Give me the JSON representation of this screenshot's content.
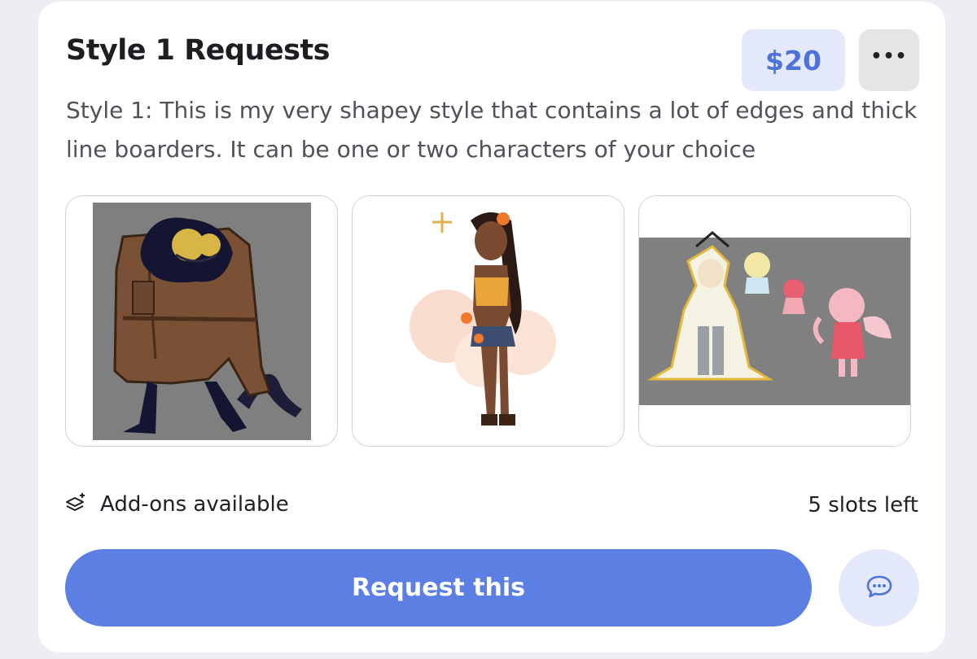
{
  "card": {
    "title": "Style 1 Requests",
    "price": "$20",
    "more_icon": "more-horizontal-icon",
    "description": "Style 1: This is my very shapey style that contains a lot of edges and thick line boarders. It can be one or two characters of your choice",
    "gallery": [
      {
        "subject": "dark-furred creature in a brown trench coat"
      },
      {
        "subject": "woman in a yellow outfit with orange flowers"
      },
      {
        "subject": "three characters on a grey background"
      }
    ],
    "addons_icon": "layers-plus-icon",
    "addons_label": "Add-ons available",
    "slots_label": "5 slots left",
    "request_label": "Request this",
    "chat_icon": "chat-bubble-icon"
  },
  "colors": {
    "accent": "#5b7fe2",
    "price_bg": "#e3e9fb",
    "price_text": "#4d72d9"
  }
}
